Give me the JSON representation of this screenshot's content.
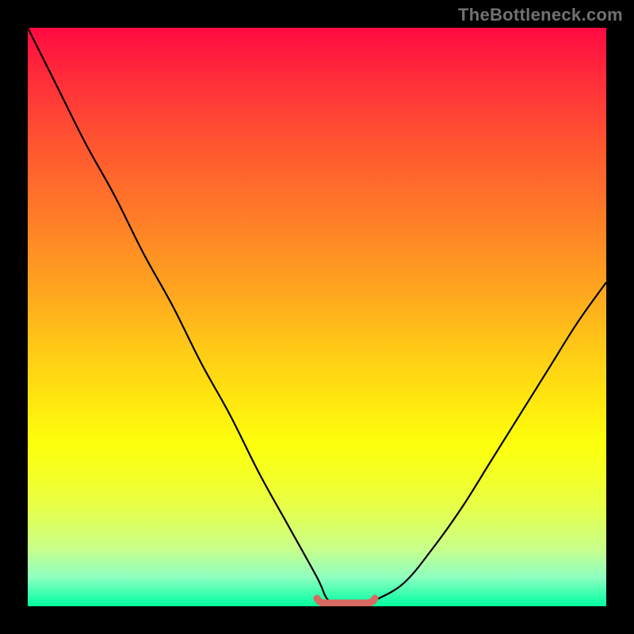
{
  "attribution": "TheBottleneck.com",
  "colors": {
    "curve_stroke": "#000000",
    "flat_segment_stroke": "#d86a63",
    "frame_bg": "#000000"
  },
  "chart_data": {
    "type": "line",
    "title": "",
    "xlabel": "",
    "ylabel": "",
    "xlim": [
      0,
      100
    ],
    "ylim": [
      0,
      100
    ],
    "series": [
      {
        "name": "bottleneck-curve",
        "x": [
          0,
          5,
          10,
          15,
          20,
          25,
          30,
          35,
          40,
          45,
          50,
          52,
          55,
          58,
          60,
          65,
          70,
          75,
          80,
          85,
          90,
          95,
          100
        ],
        "y": [
          100,
          90,
          80,
          71,
          61,
          52,
          42,
          33,
          23,
          14,
          5,
          1,
          0,
          0,
          1,
          4,
          10,
          17,
          25,
          33,
          41,
          49,
          56
        ]
      },
      {
        "name": "optimal-flat-segment",
        "x": [
          50,
          60
        ],
        "y": [
          0,
          0
        ]
      }
    ]
  }
}
